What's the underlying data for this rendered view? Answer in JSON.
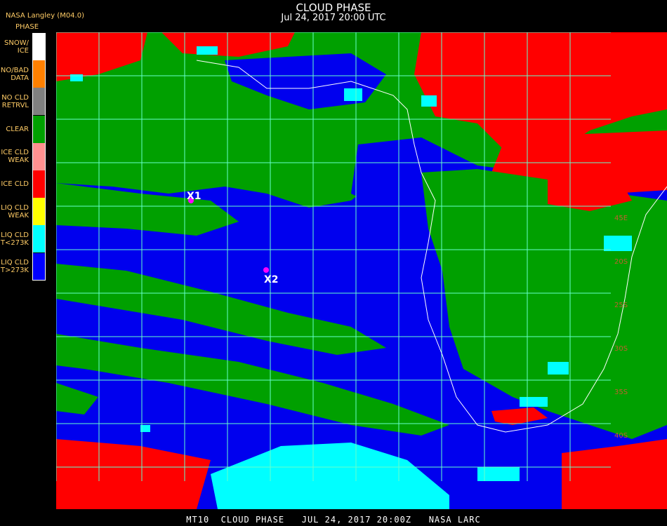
{
  "header": {
    "title": "CLOUD PHASE",
    "subtitle": "Jul 24, 2017 20:00 UTC",
    "source": "NASA Langley (M04.0)"
  },
  "legend": {
    "title": "PHASE",
    "items": [
      {
        "label": "SNOW/\nICE",
        "color": "#ffffff"
      },
      {
        "label": "NO/BAD\nDATA",
        "color": "#ff8000"
      },
      {
        "label": "NO CLD\nRETRVL",
        "color": "#808080"
      },
      {
        "label": "CLEAR",
        "color": "#00a000"
      },
      {
        "label": "ICE CLD\nWEAK",
        "color": "#ff9090"
      },
      {
        "label": "ICE CLD",
        "color": "#ff0000"
      },
      {
        "label": "LIQ CLD\nWEAK",
        "color": "#ffff00"
      },
      {
        "label": "LIQ CLD\nT<273K",
        "color": "#00ffff"
      },
      {
        "label": "LIQ CLD\nT>273K",
        "color": "#0000ff"
      }
    ]
  },
  "markers": [
    {
      "label": "X1"
    },
    {
      "label": "X2"
    }
  ],
  "grid_labels": [
    "45E",
    "20S",
    "25S",
    "30S",
    "35S",
    "40S"
  ],
  "footer": "MT10  CLOUD PHASE   JUL 24, 2017 20:00Z   NASA LARC",
  "colors": {
    "ocean_liquid": "#0000ff",
    "clear": "#00a000",
    "ice": "#ff0000",
    "cold_liquid": "#00ffff",
    "grid": "#66ffcc",
    "coast": "#ffffff",
    "marker": "#ff00ff"
  }
}
